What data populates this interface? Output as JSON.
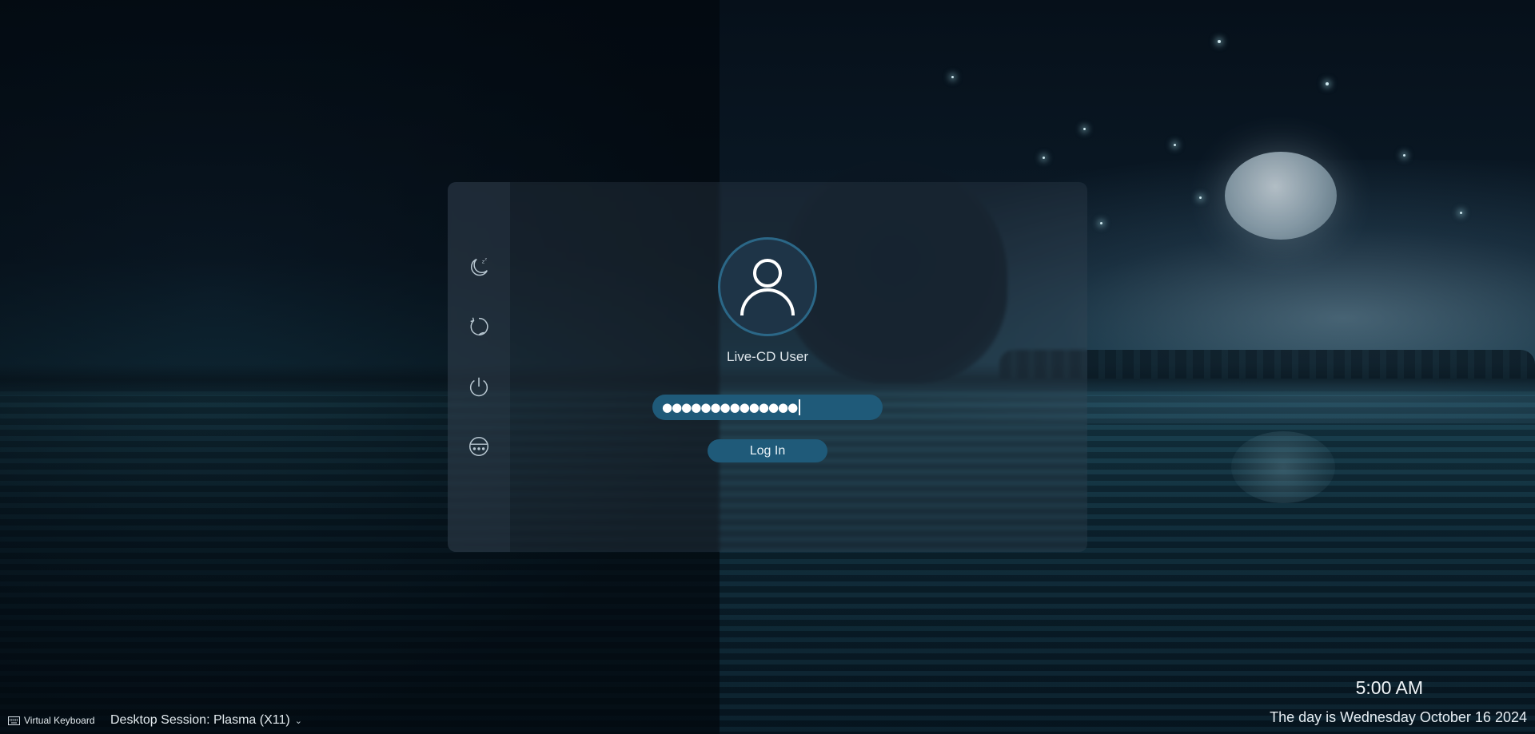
{
  "login": {
    "username": "Live-CD User",
    "password_mask": "●●●●●●●●●●●●●●",
    "login_button": "Log In"
  },
  "sidebar": {
    "items": [
      {
        "icon": "sleep-icon"
      },
      {
        "icon": "restart-icon"
      },
      {
        "icon": "power-icon"
      },
      {
        "icon": "other-user-icon"
      }
    ]
  },
  "footer": {
    "virtual_keyboard": "Virtual Keyboard",
    "session": "Desktop Session: Plasma (X11)",
    "time": "5:00 AM",
    "date": "The day is Wednesday October 16 2024"
  },
  "colors": {
    "accent": "#1f5a79",
    "avatar_ring": "#2b6787"
  }
}
